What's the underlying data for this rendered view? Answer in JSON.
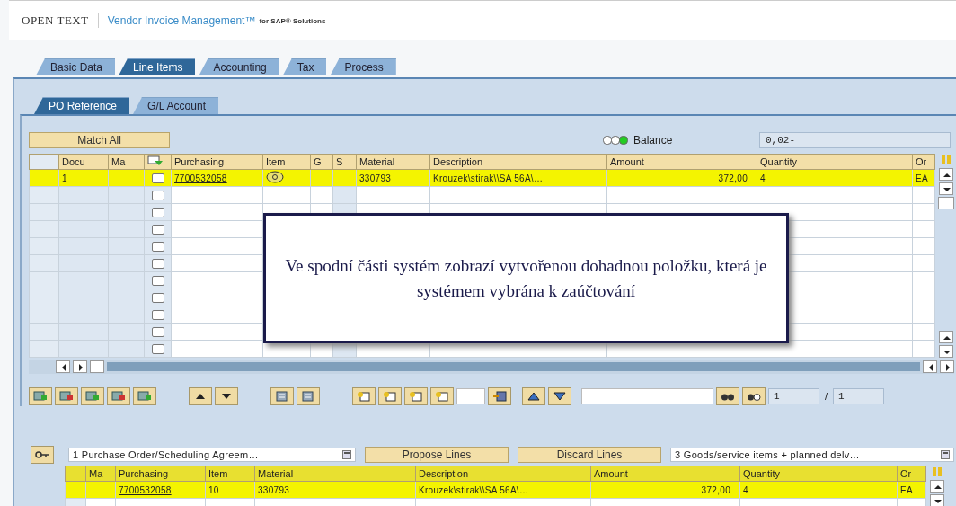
{
  "header": {
    "brand": "OPEN TEXT",
    "product": "Vendor Invoice Management™",
    "suffix": "for SAP® Solutions"
  },
  "tabs": [
    {
      "label": "Basic Data",
      "selected": false
    },
    {
      "label": "Line Items",
      "selected": true
    },
    {
      "label": "Accounting",
      "selected": false
    },
    {
      "label": "Tax",
      "selected": false
    },
    {
      "label": "Process",
      "selected": false
    }
  ],
  "subtabs": [
    {
      "label": "PO Reference",
      "selected": true
    },
    {
      "label": "G/L Account",
      "selected": false
    }
  ],
  "match_all_button": "Match All",
  "balance": {
    "label": "Balance",
    "value": "0,02-",
    "ok": true
  },
  "top_table": {
    "columns": [
      {
        "kind": "text",
        "label": "Docu"
      },
      {
        "kind": "text",
        "label": "Ma"
      },
      {
        "kind": "icon"
      },
      {
        "kind": "text",
        "label": "Purchasing"
      },
      {
        "kind": "text",
        "label": "Item"
      },
      {
        "kind": "text",
        "label": "G"
      },
      {
        "kind": "text",
        "label": "S"
      },
      {
        "kind": "text",
        "label": "Material"
      },
      {
        "kind": "text",
        "label": "Description"
      },
      {
        "kind": "text",
        "label": "Amount"
      },
      {
        "kind": "text",
        "label": "Quantity"
      },
      {
        "kind": "text",
        "label": "Or"
      }
    ],
    "rows": [
      {
        "highlighted": true,
        "cells": [
          {
            "kind": "text",
            "text": "1"
          },
          {
            "kind": "empty"
          },
          {
            "kind": "checkbox",
            "checked": false
          },
          {
            "kind": "link",
            "text": "7700532058"
          },
          {
            "kind": "icon"
          },
          {
            "kind": "empty"
          },
          {
            "kind": "empty"
          },
          {
            "kind": "text",
            "text": "330793"
          },
          {
            "kind": "text",
            "text": "Krouzek\\stirak\\\\SA 56A\\…"
          },
          {
            "kind": "amount",
            "text": "372,00"
          },
          {
            "kind": "text",
            "text": "4"
          },
          {
            "kind": "text",
            "text": "EA"
          }
        ]
      },
      {
        "highlighted": false,
        "cells": [
          {
            "kind": "empty"
          },
          {
            "kind": "empty"
          },
          {
            "kind": "checkbox",
            "checked": false
          }
        ]
      },
      {
        "highlighted": false,
        "cells": [
          {
            "kind": "empty"
          },
          {
            "kind": "empty"
          },
          {
            "kind": "checkbox",
            "checked": false
          }
        ]
      },
      {
        "highlighted": false,
        "cells": [
          {
            "kind": "empty"
          },
          {
            "kind": "empty"
          },
          {
            "kind": "checkbox",
            "checked": false
          }
        ]
      },
      {
        "highlighted": false,
        "cells": [
          {
            "kind": "empty"
          },
          {
            "kind": "empty"
          },
          {
            "kind": "checkbox",
            "checked": false
          }
        ]
      },
      {
        "highlighted": false,
        "cells": [
          {
            "kind": "empty"
          },
          {
            "kind": "empty"
          },
          {
            "kind": "checkbox",
            "checked": false
          }
        ]
      },
      {
        "highlighted": false,
        "cells": [
          {
            "kind": "empty"
          },
          {
            "kind": "empty"
          },
          {
            "kind": "checkbox",
            "checked": false
          }
        ]
      },
      {
        "highlighted": false,
        "cells": [
          {
            "kind": "empty"
          },
          {
            "kind": "empty"
          },
          {
            "kind": "checkbox",
            "checked": false
          }
        ]
      },
      {
        "highlighted": false,
        "cells": [
          {
            "kind": "empty"
          },
          {
            "kind": "empty"
          },
          {
            "kind": "checkbox",
            "checked": false
          }
        ]
      },
      {
        "highlighted": false,
        "cells": [
          {
            "kind": "empty"
          },
          {
            "kind": "empty"
          },
          {
            "kind": "checkbox",
            "checked": false
          }
        ]
      },
      {
        "highlighted": false,
        "cells": [
          {
            "kind": "empty"
          },
          {
            "kind": "empty"
          },
          {
            "kind": "checkbox",
            "checked": false
          }
        ]
      }
    ]
  },
  "callout": "Ve spodní části systém zobrazí vytvořenou dohadnou položku, která je systémem vybrána k zaúčtování",
  "pager": {
    "current": "1",
    "separator": "/",
    "total": "1"
  },
  "bottom": {
    "reference_select": "1 Purchase Order/Scheduling Agreem…",
    "propose_button": "Propose Lines",
    "discard_button": "Discard Lines",
    "items_select": "3 Goods/service items + planned delv…",
    "table": {
      "header_highlighted": true,
      "columns": [
        "Ma",
        "Purchasing",
        "Item",
        "Material",
        "Description",
        "Amount",
        "Quantity",
        "Or"
      ],
      "rows": [
        {
          "highlighted": true,
          "cells": [
            {
              "kind": "empty"
            },
            {
              "kind": "link",
              "text": "7700532058"
            },
            {
              "kind": "text",
              "text": "10"
            },
            {
              "kind": "text",
              "text": "330793"
            },
            {
              "kind": "text",
              "text": "Krouzek\\stirak\\\\SA 56A\\…"
            },
            {
              "kind": "amount",
              "text": "372,00"
            },
            {
              "kind": "text",
              "text": "4"
            },
            {
              "kind": "text",
              "text": "EA"
            }
          ]
        }
      ]
    }
  }
}
